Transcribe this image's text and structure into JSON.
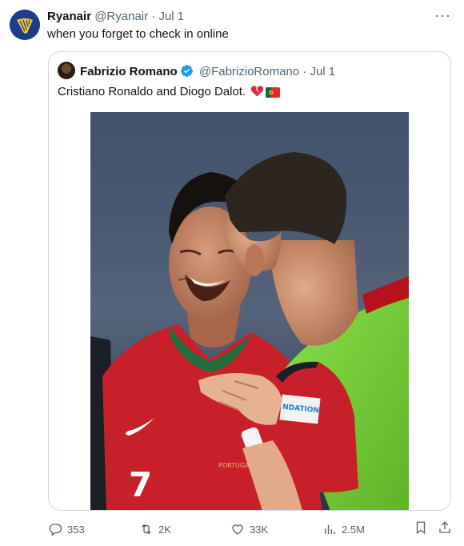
{
  "tweet": {
    "author_name": "Ryanair",
    "author_handle": "@Ryanair",
    "date_separator": "·",
    "date": "Jul 1",
    "text": "when you forget to check in online"
  },
  "quoted_tweet": {
    "author_name": "Fabrizio Romano",
    "author_handle": "@FabrizioRomano",
    "date_separator": "·",
    "date": "Jul 1",
    "text": "Cristiano Ronaldo and Diogo Dalot.",
    "verified": true,
    "emojis": [
      "broken-heart-icon",
      "portugal-flag-icon"
    ]
  },
  "photo": {
    "nike_swoosh": "nike-logo",
    "shirt_print": "PORTUGAL",
    "shirt_number": "7",
    "sleeve_badge": "NDATION"
  },
  "actions": {
    "replies": "353",
    "reposts": "2K",
    "likes": "33K",
    "views": "2.5M"
  },
  "colors": {
    "accent": "#1d9bf0",
    "muted": "#536471",
    "border": "#cfd9de",
    "kit_red": "#c8202a",
    "bib_green": "#7fd43a"
  }
}
